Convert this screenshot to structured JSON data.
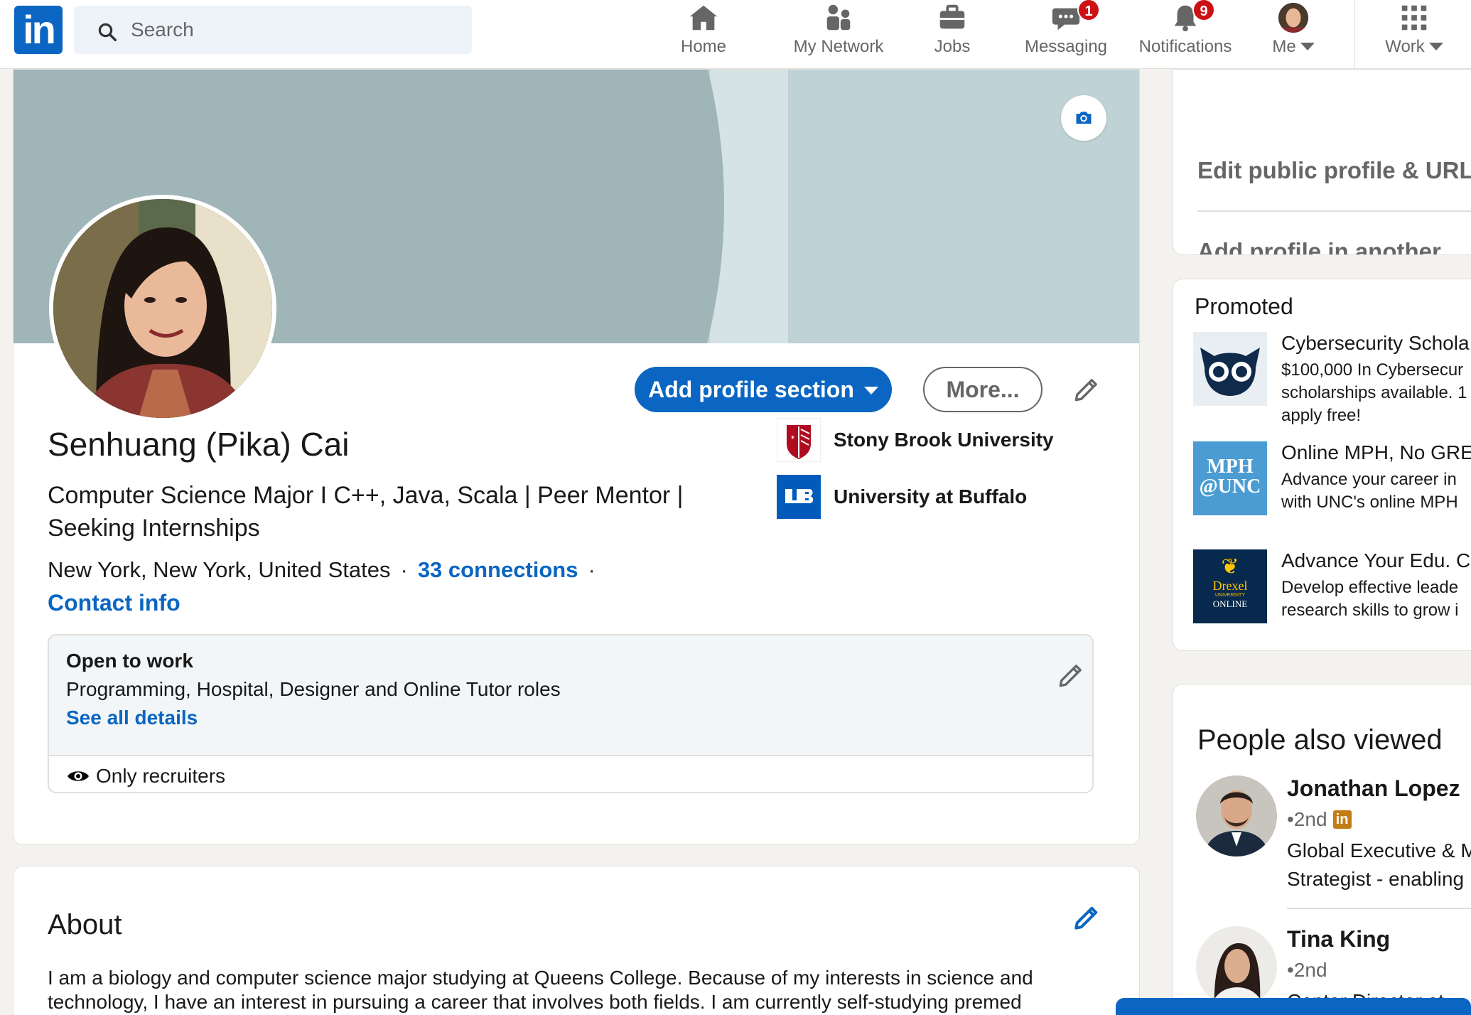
{
  "nav": {
    "logo": "in",
    "search_placeholder": "Search",
    "items": [
      {
        "label": "Home",
        "icon": "home-icon"
      },
      {
        "label": "My Network",
        "icon": "network-icon"
      },
      {
        "label": "Jobs",
        "icon": "briefcase-icon"
      },
      {
        "label": "Messaging",
        "icon": "chat-icon",
        "badge": "1"
      },
      {
        "label": "Notifications",
        "icon": "bell-icon",
        "badge": "9"
      },
      {
        "label": "Me",
        "icon": "avatar"
      },
      {
        "label": "Work",
        "icon": "grid-icon"
      }
    ]
  },
  "profile": {
    "add_section_label": "Add profile section",
    "more_label": "More...",
    "name": "Senhuang (Pika) Cai",
    "headline": "Computer Science Major I C++, Java, Scala | Peer Mentor | Seeking Internships",
    "location": "New York, New York, United States",
    "connections": "33 connections",
    "contact_info": "Contact info",
    "schools": [
      {
        "name": "Stony Brook University"
      },
      {
        "name": "University at Buffalo"
      }
    ],
    "open_to_work": {
      "title": "Open to work",
      "roles": "Programming, Hospital, Designer and Online Tutor roles",
      "details_link": "See all details",
      "visibility": "Only recruiters"
    }
  },
  "about": {
    "title": "About",
    "text": "I am a biology and computer science major studying at Queens College. Because of my interests in science and technology, I have an interest in pursuing a career that involves both fields. I am currently self-studying premed"
  },
  "sidebar": {
    "edit_public_profile": "Edit public profile & URL",
    "add_language": "Add profile in another language"
  },
  "promoted": {
    "title": "Promoted",
    "ads": [
      {
        "headline": "Cybersecurity Schola",
        "body": "$100,000 In Cybersecur\nscholarships available. 1\napply free!"
      },
      {
        "headline": "Online MPH, No GRE",
        "body": "Advance your career in\nwith UNC's online MPH"
      },
      {
        "headline": "Advance Your Edu. C",
        "body": "Develop effective leade\nresearch skills to grow i"
      }
    ],
    "logo_texts": {
      "mph": "MPH\n@UNC",
      "drexel_1": "Drexel",
      "drexel_2": "UNIVERSITY",
      "drexel_3": "ONLINE"
    }
  },
  "people_also_viewed": {
    "title": "People also viewed",
    "people": [
      {
        "name": "Jonathan Lopez",
        "degree": "•2nd",
        "desc": "Global Executive & M\nStrategist - enabling"
      },
      {
        "name": "Tina King",
        "degree": "•2nd",
        "desc": "Center Director at"
      }
    ]
  },
  "colors": {
    "brand": "#0a66c2",
    "badge": "#cc1016",
    "background": "#f3f2ef"
  }
}
